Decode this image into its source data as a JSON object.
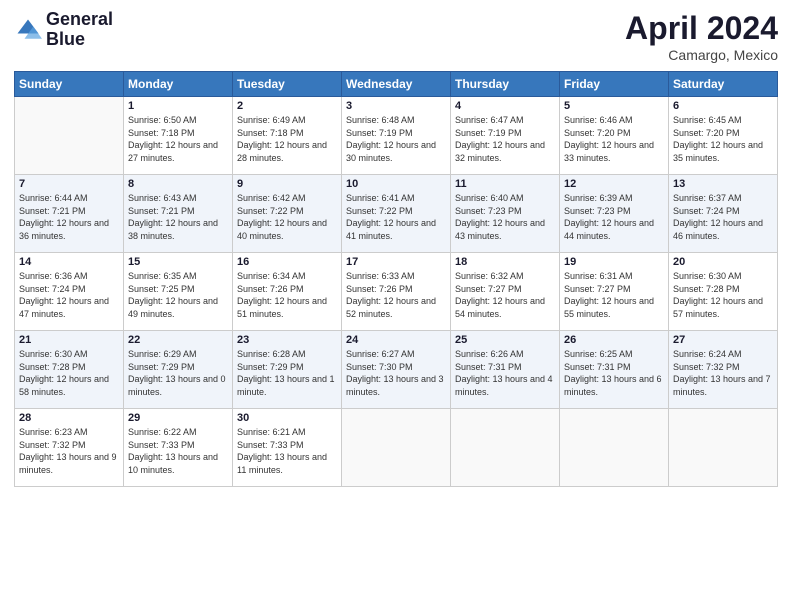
{
  "header": {
    "logo_line1": "General",
    "logo_line2": "Blue",
    "month": "April 2024",
    "location": "Camargo, Mexico"
  },
  "weekdays": [
    "Sunday",
    "Monday",
    "Tuesday",
    "Wednesday",
    "Thursday",
    "Friday",
    "Saturday"
  ],
  "weeks": [
    [
      {
        "day": "",
        "sunrise": "",
        "sunset": "",
        "daylight": ""
      },
      {
        "day": "1",
        "sunrise": "Sunrise: 6:50 AM",
        "sunset": "Sunset: 7:18 PM",
        "daylight": "Daylight: 12 hours and 27 minutes."
      },
      {
        "day": "2",
        "sunrise": "Sunrise: 6:49 AM",
        "sunset": "Sunset: 7:18 PM",
        "daylight": "Daylight: 12 hours and 28 minutes."
      },
      {
        "day": "3",
        "sunrise": "Sunrise: 6:48 AM",
        "sunset": "Sunset: 7:19 PM",
        "daylight": "Daylight: 12 hours and 30 minutes."
      },
      {
        "day": "4",
        "sunrise": "Sunrise: 6:47 AM",
        "sunset": "Sunset: 7:19 PM",
        "daylight": "Daylight: 12 hours and 32 minutes."
      },
      {
        "day": "5",
        "sunrise": "Sunrise: 6:46 AM",
        "sunset": "Sunset: 7:20 PM",
        "daylight": "Daylight: 12 hours and 33 minutes."
      },
      {
        "day": "6",
        "sunrise": "Sunrise: 6:45 AM",
        "sunset": "Sunset: 7:20 PM",
        "daylight": "Daylight: 12 hours and 35 minutes."
      }
    ],
    [
      {
        "day": "7",
        "sunrise": "Sunrise: 6:44 AM",
        "sunset": "Sunset: 7:21 PM",
        "daylight": "Daylight: 12 hours and 36 minutes."
      },
      {
        "day": "8",
        "sunrise": "Sunrise: 6:43 AM",
        "sunset": "Sunset: 7:21 PM",
        "daylight": "Daylight: 12 hours and 38 minutes."
      },
      {
        "day": "9",
        "sunrise": "Sunrise: 6:42 AM",
        "sunset": "Sunset: 7:22 PM",
        "daylight": "Daylight: 12 hours and 40 minutes."
      },
      {
        "day": "10",
        "sunrise": "Sunrise: 6:41 AM",
        "sunset": "Sunset: 7:22 PM",
        "daylight": "Daylight: 12 hours and 41 minutes."
      },
      {
        "day": "11",
        "sunrise": "Sunrise: 6:40 AM",
        "sunset": "Sunset: 7:23 PM",
        "daylight": "Daylight: 12 hours and 43 minutes."
      },
      {
        "day": "12",
        "sunrise": "Sunrise: 6:39 AM",
        "sunset": "Sunset: 7:23 PM",
        "daylight": "Daylight: 12 hours and 44 minutes."
      },
      {
        "day": "13",
        "sunrise": "Sunrise: 6:37 AM",
        "sunset": "Sunset: 7:24 PM",
        "daylight": "Daylight: 12 hours and 46 minutes."
      }
    ],
    [
      {
        "day": "14",
        "sunrise": "Sunrise: 6:36 AM",
        "sunset": "Sunset: 7:24 PM",
        "daylight": "Daylight: 12 hours and 47 minutes."
      },
      {
        "day": "15",
        "sunrise": "Sunrise: 6:35 AM",
        "sunset": "Sunset: 7:25 PM",
        "daylight": "Daylight: 12 hours and 49 minutes."
      },
      {
        "day": "16",
        "sunrise": "Sunrise: 6:34 AM",
        "sunset": "Sunset: 7:26 PM",
        "daylight": "Daylight: 12 hours and 51 minutes."
      },
      {
        "day": "17",
        "sunrise": "Sunrise: 6:33 AM",
        "sunset": "Sunset: 7:26 PM",
        "daylight": "Daylight: 12 hours and 52 minutes."
      },
      {
        "day": "18",
        "sunrise": "Sunrise: 6:32 AM",
        "sunset": "Sunset: 7:27 PM",
        "daylight": "Daylight: 12 hours and 54 minutes."
      },
      {
        "day": "19",
        "sunrise": "Sunrise: 6:31 AM",
        "sunset": "Sunset: 7:27 PM",
        "daylight": "Daylight: 12 hours and 55 minutes."
      },
      {
        "day": "20",
        "sunrise": "Sunrise: 6:30 AM",
        "sunset": "Sunset: 7:28 PM",
        "daylight": "Daylight: 12 hours and 57 minutes."
      }
    ],
    [
      {
        "day": "21",
        "sunrise": "Sunrise: 6:30 AM",
        "sunset": "Sunset: 7:28 PM",
        "daylight": "Daylight: 12 hours and 58 minutes."
      },
      {
        "day": "22",
        "sunrise": "Sunrise: 6:29 AM",
        "sunset": "Sunset: 7:29 PM",
        "daylight": "Daylight: 13 hours and 0 minutes."
      },
      {
        "day": "23",
        "sunrise": "Sunrise: 6:28 AM",
        "sunset": "Sunset: 7:29 PM",
        "daylight": "Daylight: 13 hours and 1 minute."
      },
      {
        "day": "24",
        "sunrise": "Sunrise: 6:27 AM",
        "sunset": "Sunset: 7:30 PM",
        "daylight": "Daylight: 13 hours and 3 minutes."
      },
      {
        "day": "25",
        "sunrise": "Sunrise: 6:26 AM",
        "sunset": "Sunset: 7:31 PM",
        "daylight": "Daylight: 13 hours and 4 minutes."
      },
      {
        "day": "26",
        "sunrise": "Sunrise: 6:25 AM",
        "sunset": "Sunset: 7:31 PM",
        "daylight": "Daylight: 13 hours and 6 minutes."
      },
      {
        "day": "27",
        "sunrise": "Sunrise: 6:24 AM",
        "sunset": "Sunset: 7:32 PM",
        "daylight": "Daylight: 13 hours and 7 minutes."
      }
    ],
    [
      {
        "day": "28",
        "sunrise": "Sunrise: 6:23 AM",
        "sunset": "Sunset: 7:32 PM",
        "daylight": "Daylight: 13 hours and 9 minutes."
      },
      {
        "day": "29",
        "sunrise": "Sunrise: 6:22 AM",
        "sunset": "Sunset: 7:33 PM",
        "daylight": "Daylight: 13 hours and 10 minutes."
      },
      {
        "day": "30",
        "sunrise": "Sunrise: 6:21 AM",
        "sunset": "Sunset: 7:33 PM",
        "daylight": "Daylight: 13 hours and 11 minutes."
      },
      {
        "day": "",
        "sunrise": "",
        "sunset": "",
        "daylight": ""
      },
      {
        "day": "",
        "sunrise": "",
        "sunset": "",
        "daylight": ""
      },
      {
        "day": "",
        "sunrise": "",
        "sunset": "",
        "daylight": ""
      },
      {
        "day": "",
        "sunrise": "",
        "sunset": "",
        "daylight": ""
      }
    ]
  ]
}
